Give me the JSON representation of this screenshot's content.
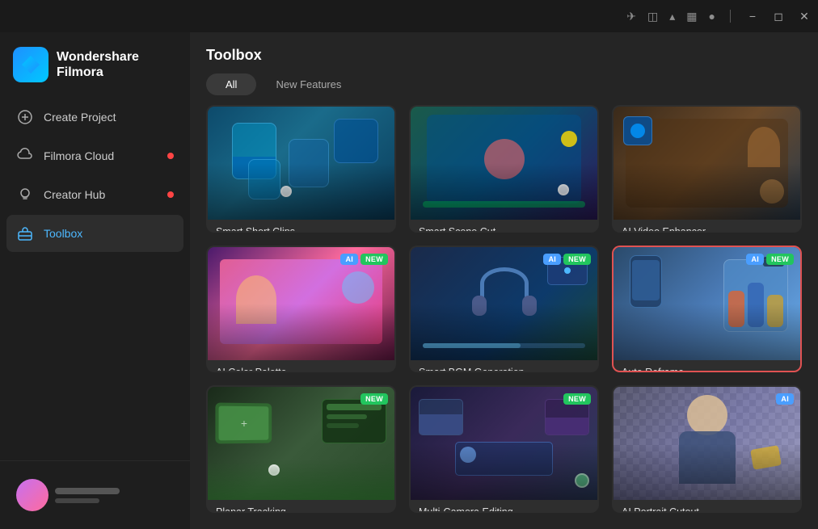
{
  "titlebar": {
    "icons": [
      "share-icon",
      "monitor-icon",
      "upload-icon",
      "grid-icon",
      "bell-icon"
    ],
    "actions": [
      "minimize-icon",
      "restore-icon",
      "close-icon"
    ]
  },
  "sidebar": {
    "logo": {
      "name": "Wondershare\nFilmora"
    },
    "nav": [
      {
        "id": "create-project",
        "label": "Create Project",
        "icon": "plus-circle",
        "dot": false
      },
      {
        "id": "filmora-cloud",
        "label": "Filmora Cloud",
        "icon": "cloud",
        "dot": true
      },
      {
        "id": "creator-hub",
        "label": "Creator Hub",
        "icon": "lightbulb",
        "dot": true
      },
      {
        "id": "toolbox",
        "label": "Toolbox",
        "icon": "toolbox",
        "dot": false,
        "active": true
      }
    ]
  },
  "toolbox": {
    "title": "Toolbox",
    "tabs": [
      {
        "id": "all",
        "label": "All",
        "active": true
      },
      {
        "id": "new-features",
        "label": "New Features",
        "active": false
      }
    ],
    "tools": [
      {
        "id": "smart-short-clips",
        "label": "Smart Short Clips",
        "badges": [],
        "thumb": "smart-short",
        "selected": false
      },
      {
        "id": "smart-scene-cut",
        "label": "Smart Scene Cut",
        "badges": [],
        "thumb": "smart-scene",
        "selected": false
      },
      {
        "id": "ai-video-enhancer",
        "label": "AI Video Enhancer",
        "badges": [],
        "thumb": "ai-video",
        "selected": false
      },
      {
        "id": "ai-color-palette",
        "label": "AI Color Palette",
        "badges": [
          "AI",
          "NEW"
        ],
        "thumb": "ai-color",
        "selected": false
      },
      {
        "id": "smart-bgm-generation",
        "label": "Smart BGM Generation",
        "badges": [
          "AI",
          "NEW"
        ],
        "thumb": "smart-bgm",
        "selected": false
      },
      {
        "id": "auto-reframe",
        "label": "Auto Reframe",
        "badges": [
          "AI",
          "NEW"
        ],
        "thumb": "auto-reframe",
        "selected": true
      },
      {
        "id": "planar-tracking",
        "label": "Planar Tracking",
        "badges": [
          "NEW"
        ],
        "thumb": "planar",
        "selected": false
      },
      {
        "id": "multi-camera-editing",
        "label": "Multi-Camera Editing",
        "badges": [
          "NEW"
        ],
        "thumb": "multicam",
        "selected": false
      },
      {
        "id": "ai-portrait-cutout",
        "label": "AI Portrait Cutout",
        "badges": [
          "AI"
        ],
        "thumb": "portrait",
        "selected": false
      }
    ]
  }
}
